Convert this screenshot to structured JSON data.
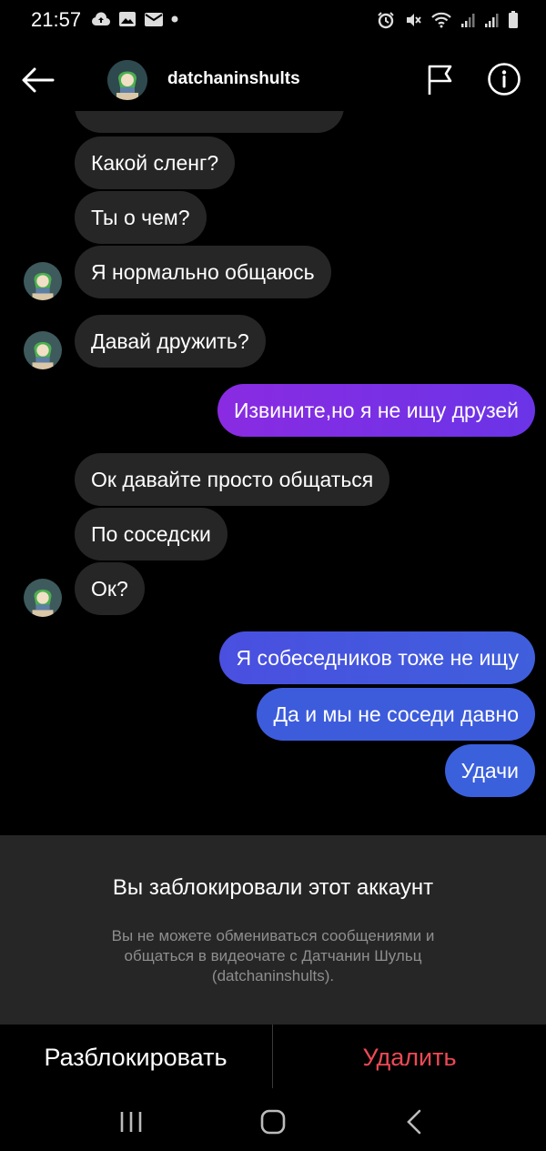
{
  "status_bar": {
    "time": "21:57"
  },
  "header": {
    "username": "datchaninshults"
  },
  "messages": [
    {
      "from": "them",
      "text": "Какой сленг?"
    },
    {
      "from": "them",
      "text": "Ты о чем?"
    },
    {
      "from": "them",
      "text": "Я нормально общаюсь"
    },
    {
      "from": "them",
      "text": "Давай дружить?"
    },
    {
      "from": "me",
      "text": "Извините,но я не ищу друзей"
    },
    {
      "from": "them",
      "text": "Ок давайте просто общаться"
    },
    {
      "from": "them",
      "text": "По соседски"
    },
    {
      "from": "them",
      "text": "Ок?"
    },
    {
      "from": "me",
      "text": "Я собеседников тоже не ищу"
    },
    {
      "from": "me",
      "text": "Да и мы не соседи давно"
    },
    {
      "from": "me",
      "text": "Удачи"
    }
  ],
  "block_notice": {
    "title": "Вы заблокировали этот аккаунт",
    "description": "Вы не можете обмениваться сообщениями и общаться в видеочате с Датчанин Шульц (datchaninshults)."
  },
  "actions": {
    "unblock_label": "Разблокировать",
    "delete_label": "Удалить"
  },
  "colors": {
    "background": "#000000",
    "incoming_bubble": "#262626",
    "outgoing_purple": "#7b2fe0",
    "outgoing_blue": "#3b5bdb",
    "delete_red": "#ed4956"
  },
  "icons": {
    "back": "arrow-left-icon",
    "flag": "flag-icon",
    "info": "info-icon",
    "nav_recent": "recent-apps-icon",
    "nav_home": "home-icon",
    "nav_back": "chevron-left-icon"
  }
}
